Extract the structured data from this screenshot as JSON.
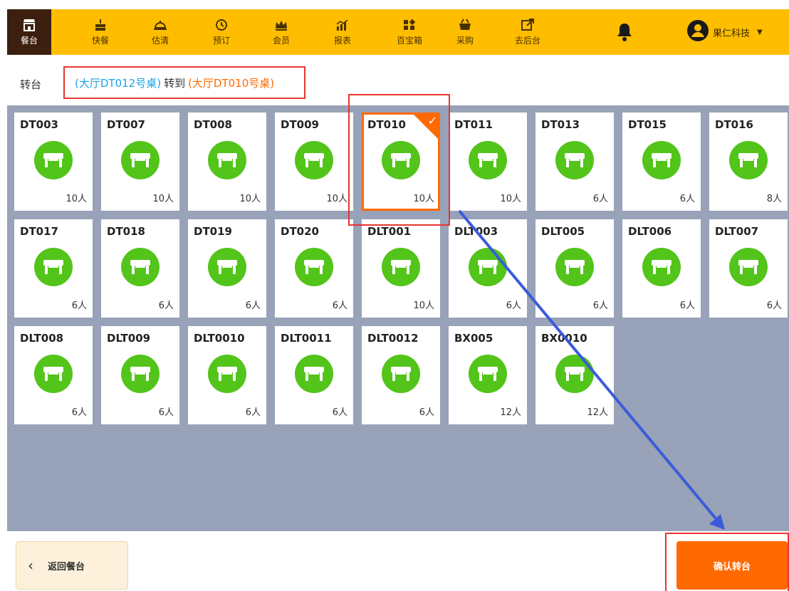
{
  "nav": [
    {
      "label": "餐台",
      "icon": "store-icon",
      "active": true
    },
    {
      "label": "快餐",
      "icon": "fastfood-icon"
    },
    {
      "label": "估清",
      "icon": "service-bell-icon"
    },
    {
      "label": "预订",
      "icon": "clock-icon"
    },
    {
      "label": "会员",
      "icon": "crown-icon"
    },
    {
      "label": "报表",
      "icon": "report-chart-icon"
    },
    {
      "label": "百宝箱",
      "icon": "apps-grid-icon"
    },
    {
      "label": "采购",
      "icon": "basket-icon"
    },
    {
      "label": "去后台",
      "icon": "external-link-icon"
    }
  ],
  "user": {
    "name": "果仁科技"
  },
  "transfer": {
    "label": "转台",
    "source": "(大厅DT012号桌)",
    "connector": "转到",
    "target": "(大厅DT010号桌)"
  },
  "tables": [
    {
      "name": "DT003",
      "cap": "10人"
    },
    {
      "name": "DT007",
      "cap": "10人"
    },
    {
      "name": "DT008",
      "cap": "10人"
    },
    {
      "name": "DT009",
      "cap": "10人"
    },
    {
      "name": "DT010",
      "cap": "10人",
      "selected": true
    },
    {
      "name": "DT011",
      "cap": "10人"
    },
    {
      "name": "DT013",
      "cap": "6人"
    },
    {
      "name": "DT015",
      "cap": "6人"
    },
    {
      "name": "DT016",
      "cap": "8人"
    },
    {
      "name": "DT017",
      "cap": "6人"
    },
    {
      "name": "DT018",
      "cap": "6人"
    },
    {
      "name": "DT019",
      "cap": "6人"
    },
    {
      "name": "DT020",
      "cap": "6人"
    },
    {
      "name": "DLT001",
      "cap": "10人"
    },
    {
      "name": "DLT003",
      "cap": "6人"
    },
    {
      "name": "DLT005",
      "cap": "6人"
    },
    {
      "name": "DLT006",
      "cap": "6人"
    },
    {
      "name": "DLT007",
      "cap": "6人"
    },
    {
      "name": "DLT008",
      "cap": "6人"
    },
    {
      "name": "DLT009",
      "cap": "6人"
    },
    {
      "name": "DLT0010",
      "cap": "6人"
    },
    {
      "name": "DLT0011",
      "cap": "6人"
    },
    {
      "name": "DLT0012",
      "cap": "6人"
    },
    {
      "name": "BX005",
      "cap": "12人"
    },
    {
      "name": "BX0010",
      "cap": "12人"
    }
  ],
  "buttons": {
    "back": "返回餐台",
    "confirm": "确认转台"
  },
  "colors": {
    "topbar": "#ffbd00",
    "active_nav": "#3d1f0f",
    "table_green": "#52c41a",
    "accent": "#ff6a00",
    "source_text": "#1aa3e6",
    "grid_bg": "#98a2b8",
    "annotation_red": "#e8352f",
    "annotation_arrow": "#3a5bd9"
  }
}
